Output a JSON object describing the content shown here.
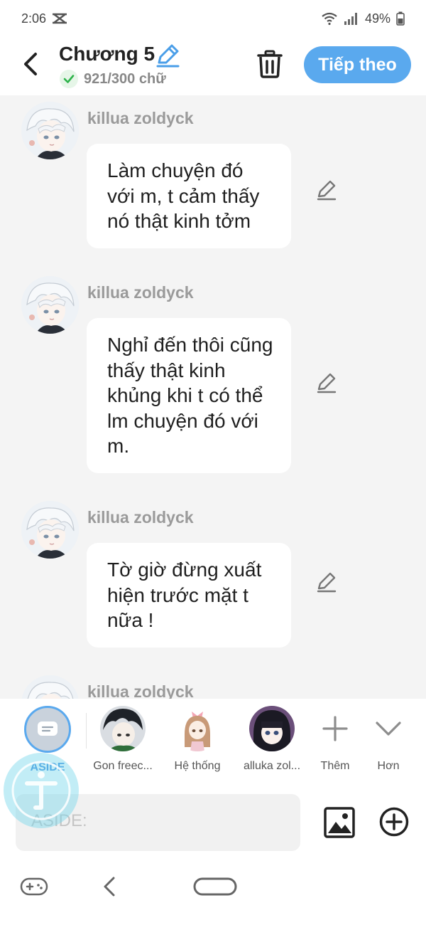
{
  "status": {
    "time": "2:06",
    "battery": "49%"
  },
  "header": {
    "title": "Chương 5",
    "word_count": "921/300 chữ",
    "next_label": "Tiếp theo"
  },
  "messages": [
    {
      "sender": "killua zoldyck",
      "text": "Làm chuyện đó với m, t cảm thấy nó thật kinh tởm"
    },
    {
      "sender": "killua zoldyck",
      "text": "Nghỉ đến thôi cũng thấy thật kinh khủng khi t có thể lm chuyện đó với m."
    },
    {
      "sender": "killua zoldyck",
      "text": "Tờ giờ đừng xuất hiện trước mặt t nữa !"
    },
    {
      "sender": "killua zoldyck",
      "text": ""
    }
  ],
  "characters": [
    {
      "label": "ASIDE",
      "icon": "aside-icon"
    },
    {
      "label": "Gon freec...",
      "icon": "avatar-gon"
    },
    {
      "label": "Hệ thống",
      "icon": "avatar-system"
    },
    {
      "label": "alluka zol...",
      "icon": "avatar-alluka"
    },
    {
      "label": "Thêm",
      "icon": "plus-icon"
    },
    {
      "label": "Hơn",
      "icon": "chevron-down-icon"
    }
  ],
  "input": {
    "placeholder": "ASIDE:"
  },
  "colors": {
    "accent": "#5aa9ee",
    "background": "#f4f4f4",
    "bubble": "#ffffff"
  }
}
